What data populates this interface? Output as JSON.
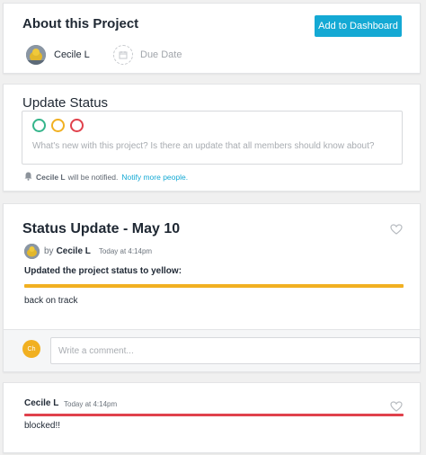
{
  "about": {
    "title": "About this Project",
    "add_button": "Add to Dashboard",
    "owner_name": "Cecile L",
    "due_date_label": "Due Date"
  },
  "update_status": {
    "title": "Update Status",
    "placeholder": "What's new with this project? Is there an update that all members should know about?",
    "status_colors": [
      "#35b58b",
      "#f1b021",
      "#e0414c"
    ],
    "notify_name": "Cecile L",
    "notify_text": "will be notified.",
    "notify_link": "Notify more people."
  },
  "status_post": {
    "title": "Status Update - May 10",
    "by": "by",
    "author": "Cecile L",
    "time": "Today at 4:14pm",
    "change_text": "Updated the project status to yellow:",
    "status_color": "#f1b021",
    "body": "back on track",
    "comment_avatar_initials": "Ch",
    "comment_placeholder": "Write a comment..."
  },
  "comment": {
    "author": "Cecile L",
    "time": "Today at 4:14pm",
    "status_color": "#e0414c",
    "body": "blocked!!"
  },
  "colors": {
    "accent": "#14a9d4",
    "page_bg": "#f0f0f0"
  }
}
